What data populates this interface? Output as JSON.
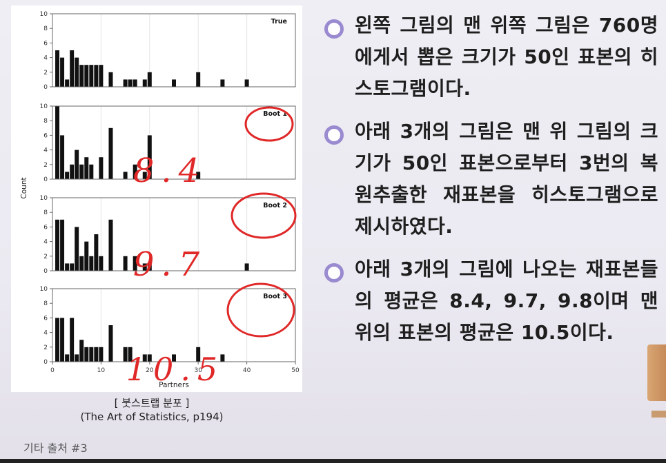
{
  "chart_data": {
    "type": "bar",
    "ylabel": "Count",
    "xlabel": "Partners",
    "x_ticks": [
      0,
      10,
      20,
      30,
      40,
      50
    ],
    "y_ticks": [
      0,
      2,
      4,
      6,
      8,
      10
    ],
    "xlim": [
      0,
      50
    ],
    "ylim": [
      0,
      10
    ],
    "panels": [
      {
        "name": "True",
        "bars": [
          [
            1,
            5
          ],
          [
            2,
            4
          ],
          [
            3,
            1
          ],
          [
            4,
            5
          ],
          [
            5,
            4
          ],
          [
            6,
            3
          ],
          [
            7,
            3
          ],
          [
            8,
            3
          ],
          [
            9,
            3
          ],
          [
            10,
            3
          ],
          [
            12,
            2
          ],
          [
            15,
            1
          ],
          [
            16,
            1
          ],
          [
            17,
            1
          ],
          [
            19,
            1
          ],
          [
            20,
            2
          ],
          [
            25,
            1
          ],
          [
            30,
            2
          ],
          [
            35,
            1
          ],
          [
            40,
            1
          ]
        ]
      },
      {
        "name": "Boot 1",
        "bars": [
          [
            1,
            10
          ],
          [
            2,
            6
          ],
          [
            3,
            1
          ],
          [
            4,
            2
          ],
          [
            5,
            4
          ],
          [
            6,
            2
          ],
          [
            7,
            3
          ],
          [
            8,
            2
          ],
          [
            10,
            3
          ],
          [
            12,
            7
          ],
          [
            15,
            1
          ],
          [
            17,
            2
          ],
          [
            19,
            1
          ],
          [
            20,
            6
          ],
          [
            30,
            1
          ]
        ]
      },
      {
        "name": "Boot 2",
        "bars": [
          [
            1,
            7
          ],
          [
            2,
            7
          ],
          [
            3,
            1
          ],
          [
            4,
            1
          ],
          [
            5,
            6
          ],
          [
            6,
            2
          ],
          [
            7,
            4
          ],
          [
            8,
            2
          ],
          [
            9,
            5
          ],
          [
            10,
            2
          ],
          [
            12,
            7
          ],
          [
            15,
            2
          ],
          [
            17,
            2
          ],
          [
            19,
            1
          ],
          [
            20,
            1
          ],
          [
            40,
            1
          ]
        ]
      },
      {
        "name": "Boot 3",
        "bars": [
          [
            1,
            6
          ],
          [
            2,
            6
          ],
          [
            3,
            1
          ],
          [
            4,
            6
          ],
          [
            5,
            1
          ],
          [
            6,
            3
          ],
          [
            7,
            2
          ],
          [
            8,
            2
          ],
          [
            9,
            2
          ],
          [
            10,
            2
          ],
          [
            12,
            5
          ],
          [
            15,
            2
          ],
          [
            16,
            2
          ],
          [
            19,
            1
          ],
          [
            20,
            1
          ],
          [
            25,
            1
          ],
          [
            30,
            2
          ],
          [
            35,
            1
          ]
        ]
      }
    ]
  },
  "annotations": [
    "8.4",
    "9.7",
    "10.5"
  ],
  "caption": {
    "line1": "[ 붓스트랩 분포 ]",
    "line2": "(The Art of Statistics, p194)"
  },
  "bullets": [
    "왼쪽 그림의 맨 위쪽 그림은 760명에게서 뽑은 크기가 50인 표본의 히스토그램이다.",
    "아래 3개의 그림은 맨 위 그림의 크기가 50인 표본으로부터 3번의 복원추출한 재표본을 히스토그램으로 제시하였다.",
    "아래 3개의 그림에 나오는 재표본들의 평균은 8.4, 9.7, 9.8이며 맨 위의 표본의 평균은 10.5이다."
  ],
  "footer": "기타 출처 #3",
  "colors": {
    "bar": "#111111",
    "ink": "#e02828",
    "bullet": "#9a8ad0"
  }
}
